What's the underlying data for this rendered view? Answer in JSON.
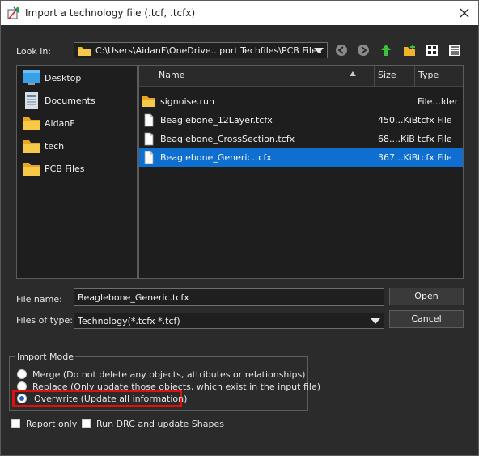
{
  "window": {
    "title": "Import a technology file (.tcf, .tcfx)"
  },
  "toolbar": {
    "look_in_label": "Look in:",
    "look_in_value": "C:\\Users\\AidanF\\OneDrive...port Techfiles\\PCB Files",
    "icons": [
      "back-icon",
      "forward-icon",
      "up-folder-icon",
      "new-folder-icon",
      "list-view-icon",
      "detail-view-icon"
    ]
  },
  "places": [
    {
      "label": "Desktop",
      "icon": "desktop-icon"
    },
    {
      "label": "Documents",
      "icon": "documents-icon"
    },
    {
      "label": "AidanF",
      "icon": "folder-icon"
    },
    {
      "label": "tech",
      "icon": "folder-icon"
    },
    {
      "label": "PCB Files",
      "icon": "folder-icon"
    }
  ],
  "file_list": {
    "columns": [
      "Name",
      "Size",
      "Type"
    ],
    "rows": [
      {
        "name": "signoise.run",
        "size": "",
        "type": "File...lder",
        "icon": "folder-icon",
        "selected": false
      },
      {
        "name": "Beaglebone_12Layer.tcfx",
        "size": "450...KiB",
        "type": "tcfx File",
        "icon": "file-icon",
        "selected": false
      },
      {
        "name": "Beaglebone_CrossSection.tcfx",
        "size": "68....KiB",
        "type": "tcfx File",
        "icon": "file-icon",
        "selected": false
      },
      {
        "name": "Beaglebone_Generic.tcfx",
        "size": "367...KiB",
        "type": "tcfx File",
        "icon": "file-icon",
        "selected": true
      }
    ]
  },
  "form": {
    "file_name_label": "File name:",
    "file_name_value": "Beaglebone_Generic.tcfx",
    "files_of_type_label": "Files of type:",
    "files_of_type_value": "Technology(*.tcfx *.tcf)",
    "open_label": "Open",
    "cancel_label": "Cancel"
  },
  "import_mode": {
    "title": "Import Mode",
    "options": [
      {
        "label": "Merge (Do not delete any objects, attributes or relationships)",
        "selected": false
      },
      {
        "label": "Replace (Only update those objects, which exist in the input file)",
        "selected": false
      },
      {
        "label": "Overwrite (Update all information)",
        "selected": true
      }
    ]
  },
  "options": {
    "report_only_label": "Report only",
    "run_drc_label": "Run DRC and update Shapes",
    "report_only_checked": false,
    "run_drc_checked": false
  },
  "colors": {
    "selection": "#0f6fd0",
    "highlight": "#e01010",
    "background": "#2b2b2b"
  }
}
